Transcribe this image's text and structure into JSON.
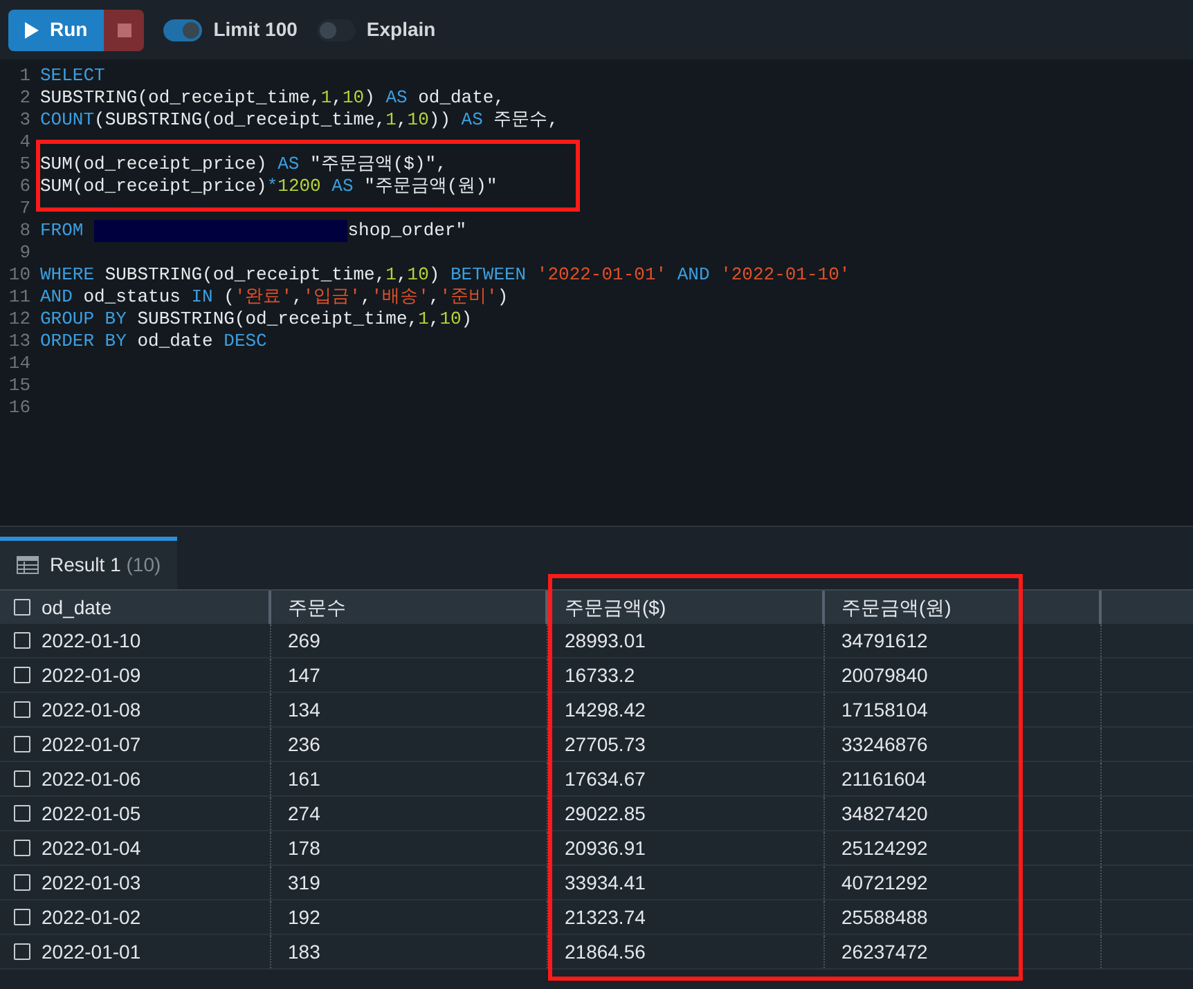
{
  "toolbar": {
    "run": "Run",
    "limit": {
      "label": "Limit 100",
      "on": true
    },
    "explain": {
      "label": "Explain",
      "on": false
    }
  },
  "editor": {
    "lines": [
      {
        "number": "1",
        "tokens": [
          {
            "kind": "kw",
            "text": "SELECT"
          }
        ]
      },
      {
        "number": "2",
        "tokens": [
          {
            "kind": "plain",
            "text": "SUBSTRING(od_receipt_time,"
          },
          {
            "kind": "num",
            "text": "1"
          },
          {
            "kind": "plain",
            "text": ","
          },
          {
            "kind": "num",
            "text": "10"
          },
          {
            "kind": "plain",
            "text": ")"
          },
          {
            "kind": "kw",
            "text": " AS"
          },
          {
            "kind": "plain",
            "text": " od_date,"
          }
        ]
      },
      {
        "number": "3",
        "tokens": [
          {
            "kind": "kw",
            "text": "COUNT"
          },
          {
            "kind": "plain",
            "text": "(SUBSTRING(od_receipt_time,"
          },
          {
            "kind": "num",
            "text": "1"
          },
          {
            "kind": "plain",
            "text": ","
          },
          {
            "kind": "num",
            "text": "10"
          },
          {
            "kind": "plain",
            "text": "))"
          },
          {
            "kind": "kw",
            "text": " AS"
          },
          {
            "kind": "plain",
            "text": " 주문수,"
          }
        ]
      },
      {
        "number": "4"
      },
      {
        "number": "5",
        "tokens": [
          {
            "kind": "plain",
            "text": "SUM(od_receipt_price)"
          },
          {
            "kind": "kw",
            "text": " AS"
          },
          {
            "kind": "plain",
            "text": " \"주문금액($)\","
          }
        ]
      },
      {
        "number": "6",
        "tokens": [
          {
            "kind": "plain",
            "text": "SUM(od_receipt_price)"
          },
          {
            "kind": "kw",
            "text": "*"
          },
          {
            "kind": "num",
            "text": "1200"
          },
          {
            "kind": "kw",
            "text": " AS"
          },
          {
            "kind": "plain",
            "text": " \"주문금액(원)\""
          }
        ]
      },
      {
        "number": "7"
      },
      {
        "number": "8",
        "tokens": [
          {
            "kind": "kw",
            "text": "FROM"
          },
          {
            "kind": "redacted"
          },
          {
            "kind": "plain",
            "text": "shop_order\""
          }
        ]
      },
      {
        "number": "9"
      },
      {
        "number": "10",
        "tokens": [
          {
            "kind": "kw",
            "text": "WHERE"
          },
          {
            "kind": "plain",
            "text": " SUBSTRING(od_receipt_time,"
          },
          {
            "kind": "num",
            "text": "1"
          },
          {
            "kind": "plain",
            "text": ","
          },
          {
            "kind": "num",
            "text": "10"
          },
          {
            "kind": "plain",
            "text": ")"
          },
          {
            "kind": "kw",
            "text": " BETWEEN"
          },
          {
            "kind": "str",
            "text": " '2022-01-01'"
          },
          {
            "kind": "kw",
            "text": " AND"
          },
          {
            "kind": "str",
            "text": " '2022-01-10'"
          }
        ]
      },
      {
        "number": "11",
        "tokens": [
          {
            "kind": "kw",
            "text": "AND"
          },
          {
            "kind": "plain",
            "text": " od_status"
          },
          {
            "kind": "kw",
            "text": " IN"
          },
          {
            "kind": "plain",
            "text": " ("
          },
          {
            "kind": "str",
            "text": "'완료'"
          },
          {
            "kind": "plain",
            "text": ","
          },
          {
            "kind": "str",
            "text": "'입금'"
          },
          {
            "kind": "plain",
            "text": ","
          },
          {
            "kind": "str",
            "text": "'배송'"
          },
          {
            "kind": "plain",
            "text": ","
          },
          {
            "kind": "str",
            "text": "'준비'"
          },
          {
            "kind": "plain",
            "text": ")"
          }
        ]
      },
      {
        "number": "12",
        "tokens": [
          {
            "kind": "kw",
            "text": "GROUP BY"
          },
          {
            "kind": "plain",
            "text": " SUBSTRING(od_receipt_time,"
          },
          {
            "kind": "num",
            "text": "1"
          },
          {
            "kind": "plain",
            "text": ","
          },
          {
            "kind": "num",
            "text": "10"
          },
          {
            "kind": "plain",
            "text": ")"
          }
        ]
      },
      {
        "number": "13",
        "tokens": [
          {
            "kind": "kw",
            "text": "ORDER BY"
          },
          {
            "kind": "plain",
            "text": " od_date"
          },
          {
            "kind": "kw",
            "text": " DESC"
          }
        ]
      },
      {
        "number": "14"
      },
      {
        "number": "15"
      },
      {
        "number": "16"
      }
    ]
  },
  "result_tab": {
    "label": "Result 1",
    "count": "(10)",
    "selected": true
  },
  "table": {
    "select_all_checked": false,
    "columns": [
      "od_date",
      "주문수",
      "주문금액($)",
      "주문금액(원)"
    ],
    "rows": [
      {
        "checked": false,
        "cells": [
          "2022-01-10",
          "269",
          "28993.01",
          "34791612"
        ]
      },
      {
        "checked": false,
        "cells": [
          "2022-01-09",
          "147",
          "16733.2",
          "20079840"
        ]
      },
      {
        "checked": false,
        "cells": [
          "2022-01-08",
          "134",
          "14298.42",
          "17158104"
        ]
      },
      {
        "checked": false,
        "cells": [
          "2022-01-07",
          "236",
          "27705.73",
          "33246876"
        ]
      },
      {
        "checked": false,
        "cells": [
          "2022-01-06",
          "161",
          "17634.67",
          "21161604"
        ]
      },
      {
        "checked": false,
        "cells": [
          "2022-01-05",
          "274",
          "29022.85",
          "34827420"
        ]
      },
      {
        "checked": false,
        "cells": [
          "2022-01-04",
          "178",
          "20936.91",
          "25124292"
        ]
      },
      {
        "checked": false,
        "cells": [
          "2022-01-03",
          "319",
          "33934.41",
          "40721292"
        ]
      },
      {
        "checked": false,
        "cells": [
          "2022-01-02",
          "192",
          "21323.74",
          "25588488"
        ]
      },
      {
        "checked": false,
        "cells": [
          "2022-01-01",
          "183",
          "21864.56",
          "26237472"
        ]
      }
    ]
  }
}
